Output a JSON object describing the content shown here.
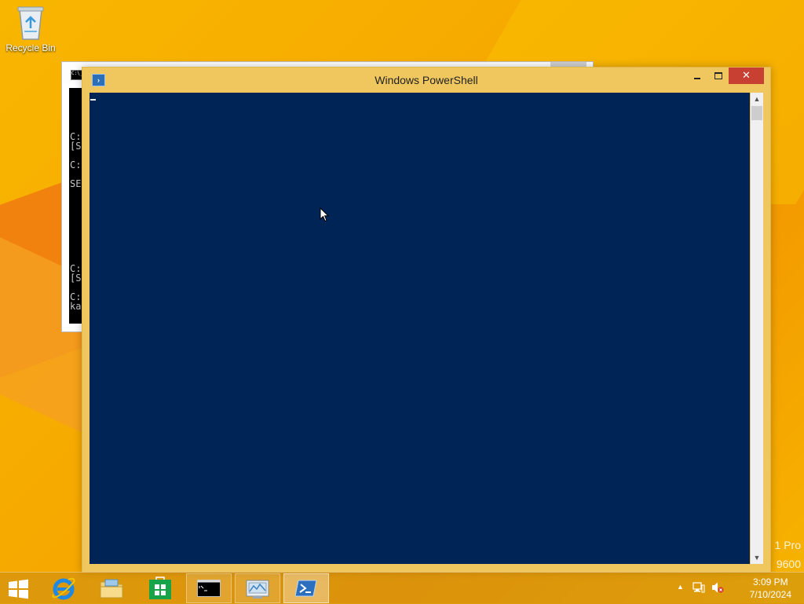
{
  "desktop": {
    "icons": [
      {
        "label": "Recycle Bin",
        "icon": "recycle-bin-icon"
      }
    ],
    "watermark": {
      "line1": "1 Pro",
      "line2": "9600"
    }
  },
  "cmd_window": {
    "icon_text": "C:\\_",
    "lines": [
      "C:",
      "[S",
      "C:",
      "SE",
      "C:",
      "[S",
      "C:",
      "ka"
    ]
  },
  "powershell": {
    "title": "Windows PowerShell",
    "buttons": {
      "minimize": "minimize",
      "maximize": "maximize",
      "close": "✕"
    },
    "scroll": {
      "up": "▲",
      "down": "▼"
    }
  },
  "taskbar": {
    "items": [
      {
        "name": "internet-explorer",
        "icon": "internet-explorer-icon",
        "state": "pinned"
      },
      {
        "name": "file-explorer",
        "icon": "folder-icon",
        "state": "pinned"
      },
      {
        "name": "store",
        "icon": "store-icon",
        "state": "pinned"
      },
      {
        "name": "command-prompt",
        "icon": "cmd-icon",
        "state": "open"
      },
      {
        "name": "control-panel",
        "icon": "control-panel-icon",
        "state": "open"
      },
      {
        "name": "powershell",
        "icon": "powershell-icon",
        "state": "active"
      }
    ],
    "tray": {
      "show_hidden": "▲",
      "time": "3:09 PM",
      "date": "7/10/2024"
    }
  },
  "colors": {
    "desktop": "#f6a800",
    "ps_frame": "#f0c75e",
    "ps_console": "#012456",
    "close_button": "#c84031"
  }
}
